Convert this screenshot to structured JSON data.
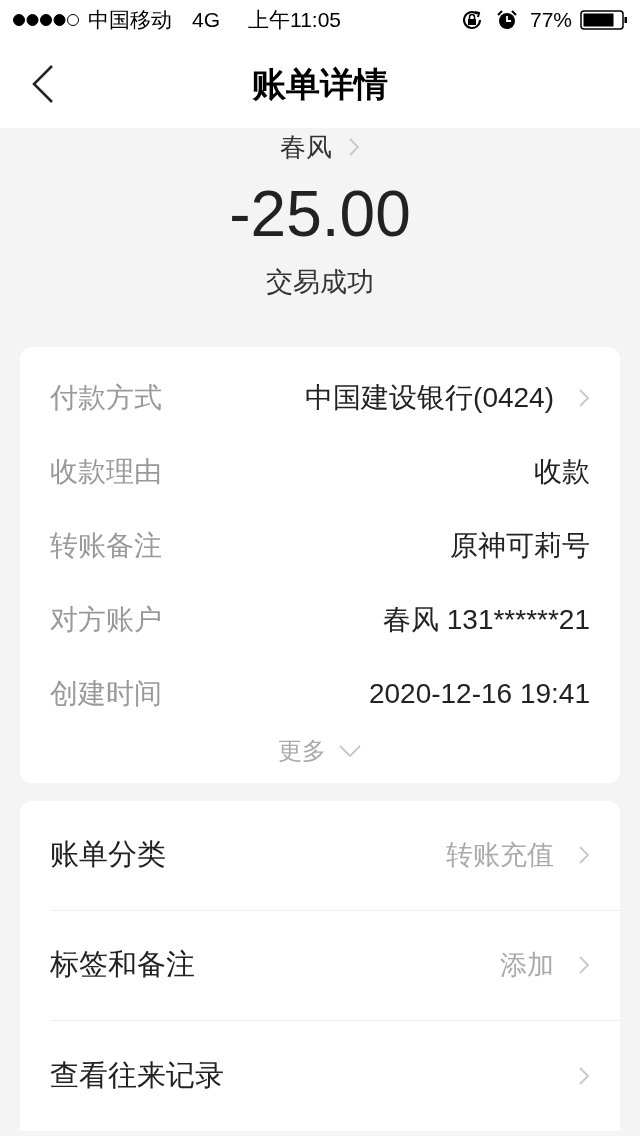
{
  "status_bar": {
    "carrier": "中国移动",
    "network": "4G",
    "time": "上午11:05",
    "battery": "77%"
  },
  "header": {
    "title": "账单详情"
  },
  "summary": {
    "payee": "春风",
    "amount": "-25.00",
    "status": "交易成功"
  },
  "details": [
    {
      "label": "付款方式",
      "value": "中国建设银行(0424)",
      "has_arrow": true
    },
    {
      "label": "收款理由",
      "value": "收款",
      "has_arrow": false
    },
    {
      "label": "转账备注",
      "value": "原神可莉号",
      "has_arrow": false
    },
    {
      "label": "对方账户",
      "value": "春风 131******21",
      "has_arrow": false
    },
    {
      "label": "创建时间",
      "value": "2020-12-16 19:41",
      "has_arrow": false
    }
  ],
  "more": {
    "label": "更多",
    "expanded": false
  },
  "actions": [
    {
      "label": "账单分类",
      "value": "转账充值"
    },
    {
      "label": "标签和备注",
      "value": "添加"
    },
    {
      "label": "查看往来记录"
    }
  ]
}
